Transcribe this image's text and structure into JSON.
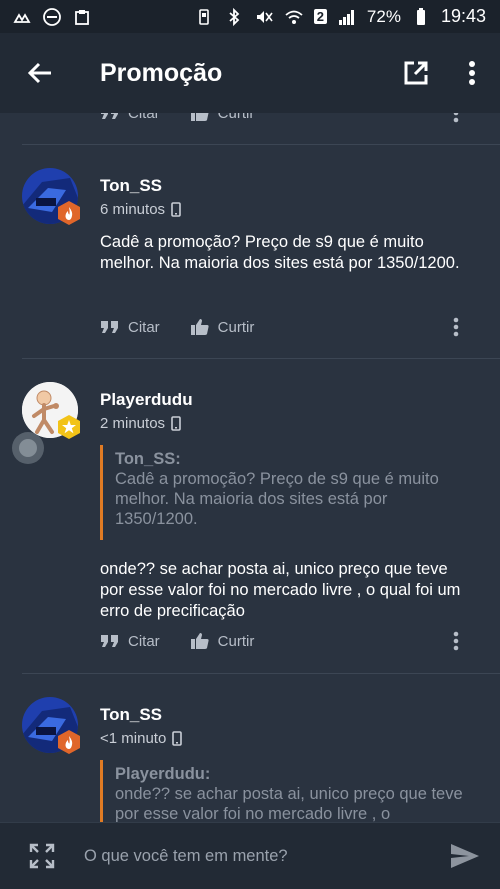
{
  "status_bar": {
    "battery": "72%",
    "time": "19:43",
    "network_badge": "2"
  },
  "app_bar": {
    "title": "Promoção"
  },
  "actions": {
    "quote_label": "Citar",
    "like_label": "Curtir"
  },
  "posts": [
    {
      "author": "Ton_SS",
      "time": "6 minutos",
      "text": "Cadê a promoção? Preço de s9 que é muito melhor. Na maioria dos sites está por 1350/1200."
    },
    {
      "author": "Playerdudu",
      "time": "2 minutos",
      "quote_author": "Ton_SS:",
      "quote_text": "Cadê a promoção? Preço de s9 que é muito melhor. Na maioria dos sites está por 1350/1200.",
      "text": "onde?? se achar posta ai, unico preço que teve por esse valor foi no mercado livre , o qual foi um erro de precificação"
    },
    {
      "author": "Ton_SS",
      "time": "<1 minuto",
      "quote_author": "Playerdudu:",
      "quote_text": "onde?? se achar posta ai, unico preço que teve por esse valor foi no mercado livre , o"
    }
  ],
  "composer": {
    "placeholder": "O que você tem em mente?"
  },
  "colors": {
    "background": "#2a3340",
    "app_bar": "#222a35",
    "status_bar": "#1b222b",
    "quote_border": "#e07b24",
    "badge": "#e0662a"
  }
}
